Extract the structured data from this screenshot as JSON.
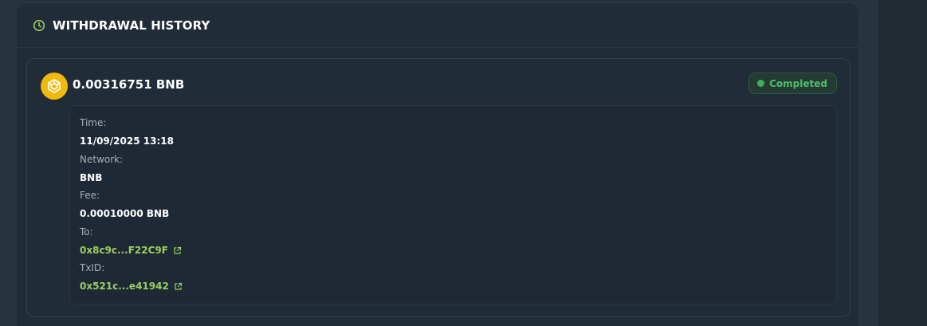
{
  "panel": {
    "title": "WITHDRAWAL HISTORY",
    "header_icon": "clock-icon"
  },
  "withdrawal": {
    "amount": "0.00316751 BNB",
    "coin_icon": "bnb-logo-icon",
    "status": "Completed",
    "fields": {
      "time_label": "Time:",
      "time_value": "11/09/2025 13:18",
      "network_label": "Network:",
      "network_value": "BNB",
      "fee_label": "Fee:",
      "fee_value": "0.00010000 BNB",
      "to_label": "To:",
      "to_value": "0x8c9c...F22C9F",
      "txid_label": "TxID:",
      "txid_value": "0x521c...e41942"
    },
    "link_icon": "external-link-icon"
  },
  "colors": {
    "accent_green": "#9bcf5f",
    "status_green": "#4fbf6a",
    "bnb_yellow": "#f0b90b",
    "panel_bg": "#202c38"
  }
}
